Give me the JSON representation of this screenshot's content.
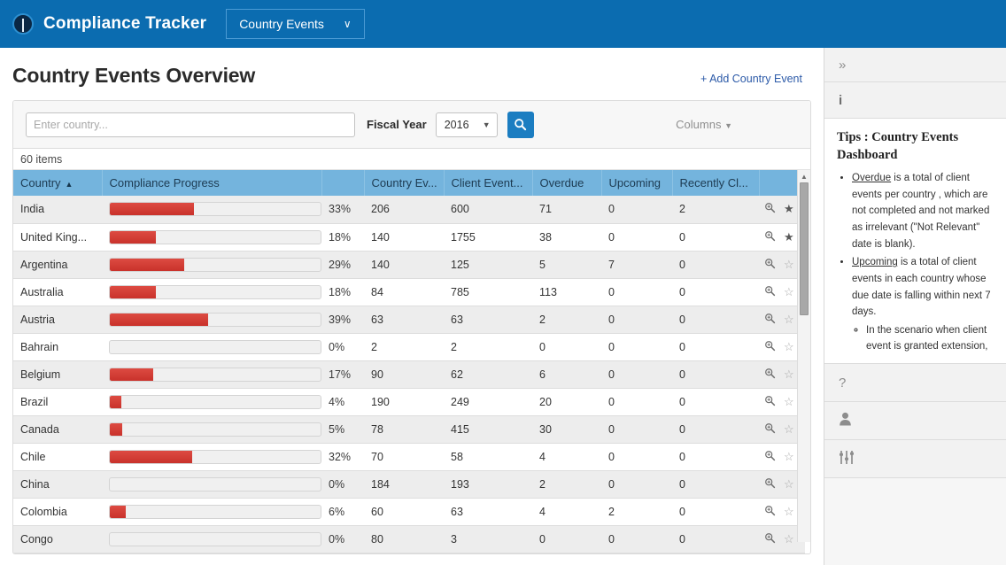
{
  "appbar": {
    "logo_icon": "compass-circle-icon",
    "title": "Compliance Tracker",
    "nav_tab_label": "Country Events",
    "nav_tab_caret": "∨",
    "background_color": "#0b6cb0"
  },
  "page": {
    "title": "Country Events Overview",
    "add_link_label": "+ Add Country Event",
    "add_link_color": "#2c5aa8"
  },
  "filters": {
    "country_placeholder": "Enter country...",
    "country_value": "",
    "fiscal_year_label": "Fiscal Year",
    "fiscal_year_value": "2016",
    "fiscal_year_options": [
      "2016"
    ],
    "fiscal_year_caret": "▼",
    "search_icon": "search-icon",
    "search_button_color": "#1b7dc1",
    "columns_label": "Columns",
    "columns_caret": "▼"
  },
  "grid": {
    "item_count_label": "60 items",
    "header_color": "#74b4dd",
    "accent_bar_color": "#cc3a32",
    "sort_column": "Country",
    "sort_arrow": "▲",
    "columns": [
      "Country",
      "Compliance Progress",
      "",
      "Country Ev...",
      "Client Event...",
      "Overdue",
      "Upcoming",
      "Recently Cl...",
      ""
    ],
    "magnifier_icon": "magnifier-icon",
    "star_filled_icon": "star-filled-icon",
    "star_outline_icon": "star-outline-icon",
    "star_filled_glyph": "★",
    "star_outline_glyph": "☆",
    "rows": [
      {
        "country": "India",
        "percent": "33%",
        "bar_ratio": 0.4,
        "country_events": "206",
        "client_events": "600",
        "overdue": "71",
        "upcoming": "0",
        "recently_closed": "2",
        "favorite": true
      },
      {
        "country": "United King...",
        "percent": "18%",
        "bar_ratio": 0.22,
        "country_events": "140",
        "client_events": "1755",
        "overdue": "38",
        "upcoming": "0",
        "recently_closed": "0",
        "favorite": true
      },
      {
        "country": "Argentina",
        "percent": "29%",
        "bar_ratio": 0.355,
        "country_events": "140",
        "client_events": "125",
        "overdue": "5",
        "upcoming": "7",
        "recently_closed": "0",
        "favorite": false
      },
      {
        "country": "Australia",
        "percent": "18%",
        "bar_ratio": 0.22,
        "country_events": "84",
        "client_events": "785",
        "overdue": "113",
        "upcoming": "0",
        "recently_closed": "0",
        "favorite": false
      },
      {
        "country": "Austria",
        "percent": "39%",
        "bar_ratio": 0.465,
        "country_events": "63",
        "client_events": "63",
        "overdue": "2",
        "upcoming": "0",
        "recently_closed": "0",
        "favorite": false
      },
      {
        "country": "Bahrain",
        "percent": "0%",
        "bar_ratio": 0.0,
        "country_events": "2",
        "client_events": "2",
        "overdue": "0",
        "upcoming": "0",
        "recently_closed": "0",
        "favorite": false
      },
      {
        "country": "Belgium",
        "percent": "17%",
        "bar_ratio": 0.205,
        "country_events": "90",
        "client_events": "62",
        "overdue": "6",
        "upcoming": "0",
        "recently_closed": "0",
        "favorite": false
      },
      {
        "country": "Brazil",
        "percent": "4%",
        "bar_ratio": 0.055,
        "country_events": "190",
        "client_events": "249",
        "overdue": "20",
        "upcoming": "0",
        "recently_closed": "0",
        "favorite": false
      },
      {
        "country": "Canada",
        "percent": "5%",
        "bar_ratio": 0.06,
        "country_events": "78",
        "client_events": "415",
        "overdue": "30",
        "upcoming": "0",
        "recently_closed": "0",
        "favorite": false
      },
      {
        "country": "Chile",
        "percent": "32%",
        "bar_ratio": 0.39,
        "country_events": "70",
        "client_events": "58",
        "overdue": "4",
        "upcoming": "0",
        "recently_closed": "0",
        "favorite": false
      },
      {
        "country": "China",
        "percent": "0%",
        "bar_ratio": 0.0,
        "country_events": "184",
        "client_events": "193",
        "overdue": "2",
        "upcoming": "0",
        "recently_closed": "0",
        "favorite": false
      },
      {
        "country": "Colombia",
        "percent": "6%",
        "bar_ratio": 0.075,
        "country_events": "60",
        "client_events": "63",
        "overdue": "4",
        "upcoming": "2",
        "recently_closed": "0",
        "favorite": false
      },
      {
        "country": "Congo",
        "percent": "0%",
        "bar_ratio": 0.0,
        "country_events": "80",
        "client_events": "3",
        "overdue": "0",
        "upcoming": "0",
        "recently_closed": "0",
        "favorite": false
      }
    ]
  },
  "rail": {
    "collapse_icon": "chevron-double-right-icon",
    "collapse_glyph": "»",
    "info_icon": "info-icon",
    "info_glyph": "i",
    "tips_title": "Tips : Country Events Dashboard",
    "tips": [
      {
        "term": "Overdue",
        "text": " is a total of client events per country , which are not completed and not marked as irrelevant (\"Not Relevant\" date is blank).",
        "sub": []
      },
      {
        "term": "Upcoming",
        "text": " is a total of client events in each country whose due date is falling within next 7 days.",
        "sub": [
          "In the scenario when client event is granted extension,"
        ]
      }
    ],
    "help_icon": "question-mark-icon",
    "help_glyph": "?",
    "user_icon": "person-icon",
    "settings_icon": "sliders-icon"
  }
}
